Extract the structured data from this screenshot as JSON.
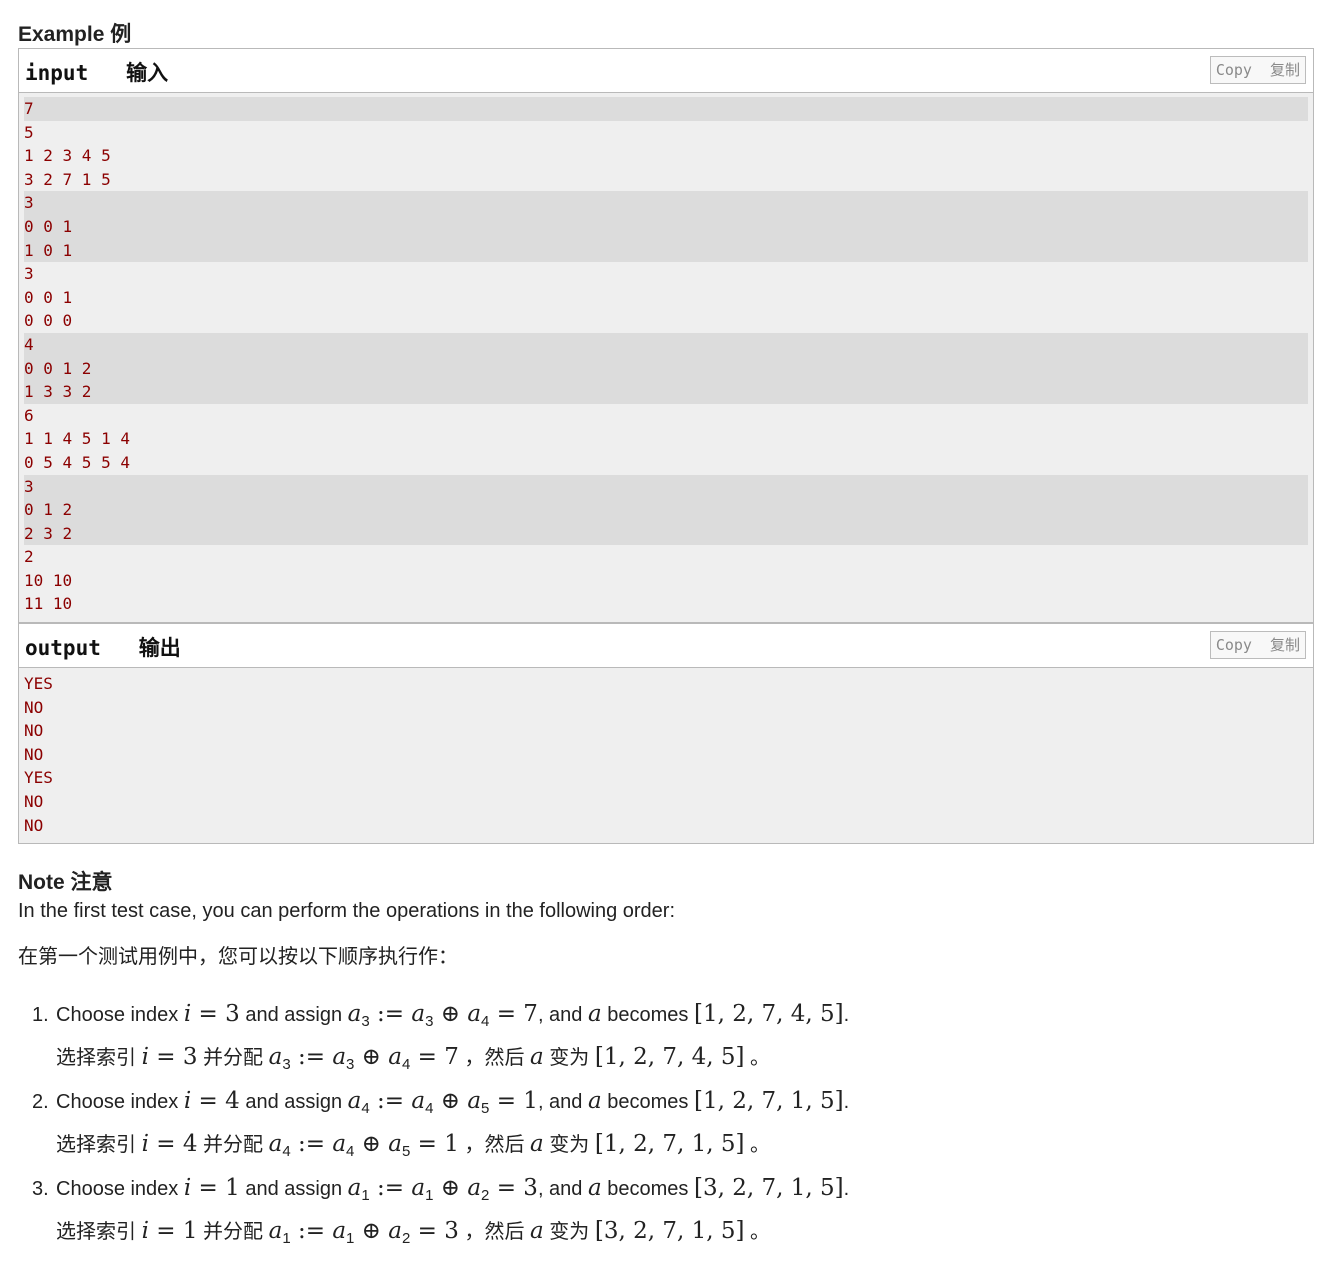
{
  "example": {
    "title": "Example 例",
    "input": {
      "label": "input   输入",
      "copy_label": "Copy  复制",
      "lines": [
        "7",
        "5",
        "1 2 3 4 5",
        "3 2 7 1 5",
        "3",
        "0 0 1",
        "1 0 1",
        "3",
        "0 0 1",
        "0 0 0",
        "4",
        "0 0 1 2",
        "1 3 3 2",
        "6",
        "1 1 4 5 1 4",
        "0 5 4 5 5 4",
        "3",
        "0 1 2",
        "2 3 2",
        "2",
        "10 10",
        "11 10"
      ],
      "shaded": [
        true,
        false,
        false,
        false,
        true,
        true,
        true,
        false,
        false,
        false,
        true,
        true,
        true,
        false,
        false,
        false,
        true,
        true,
        true,
        false,
        false,
        false
      ]
    },
    "output": {
      "label": "output   输出",
      "copy_label": "Copy  复制",
      "lines": [
        "YES",
        "NO",
        "NO",
        "NO",
        "YES",
        "NO",
        "NO"
      ]
    }
  },
  "note": {
    "title": "Note 注意",
    "intro_en": "In the first test case, you can perform the operations in the following order:",
    "intro_zh": "在第一个测试用例中，您可以按以下顺序执行作：",
    "items": [
      {
        "num": "1.",
        "en_prefix": "Choose index ",
        "idx": "3",
        "en_assign": " and assign ",
        "a": "3",
        "b": "4",
        "r": "7",
        "en_becomes": ", and ",
        "en_becomes2": " becomes ",
        "arr": "[1, 2, 7, 4, 5]",
        "zh_prefix": "选择索引 ",
        "zh_assign": " 并分配 ",
        "zh_then": " ，然后 ",
        "zh_becomes": " 变为 ",
        "zh_end": " 。"
      },
      {
        "num": "2.",
        "en_prefix": "Choose index ",
        "idx": "4",
        "en_assign": " and assign ",
        "a": "4",
        "b": "5",
        "r": "1",
        "en_becomes": ", and ",
        "en_becomes2": " becomes ",
        "arr": "[1, 2, 7, 1, 5]",
        "zh_prefix": "选择索引 ",
        "zh_assign": " 并分配 ",
        "zh_then": " ，然后 ",
        "zh_becomes": " 变为 ",
        "zh_end": " 。"
      },
      {
        "num": "3.",
        "en_prefix": "Choose index ",
        "idx": "1",
        "en_assign": " and assign ",
        "a": "1",
        "b": "2",
        "r": "3",
        "en_becomes": ", and ",
        "en_becomes2": " becomes ",
        "arr": "[3, 2, 7, 1, 5]",
        "zh_prefix": "选择索引 ",
        "zh_assign": " 并分配 ",
        "zh_then": " ，然后 ",
        "zh_becomes": " 变为 ",
        "zh_end": " 。"
      }
    ]
  }
}
